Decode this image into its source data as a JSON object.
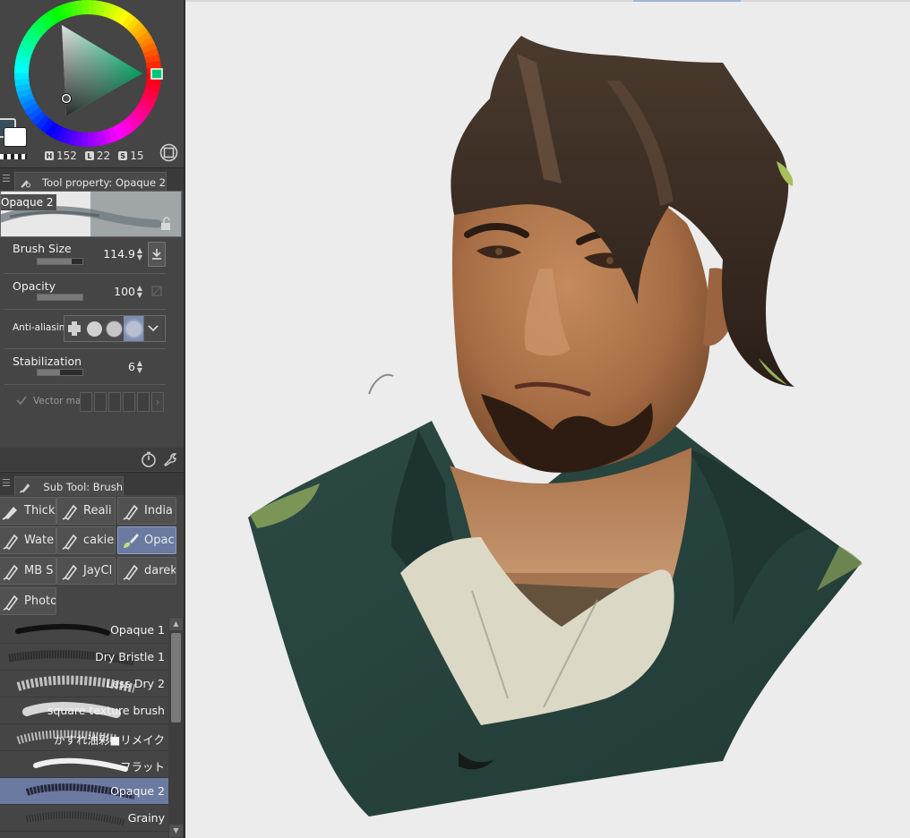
{
  "color_panel": {
    "hls": [
      {
        "key": "H",
        "value": "152"
      },
      {
        "key": "L",
        "value": "22"
      },
      {
        "key": "S",
        "value": "15"
      }
    ],
    "colors": {
      "foreground": "#36505a",
      "background": "#ffffff",
      "selected_hue": "#00c878"
    }
  },
  "tool_property": {
    "tab_label": "Tool property: Opaque 2",
    "preview_name": "Opaque 2",
    "brush_size": {
      "label": "Brush Size",
      "value": "114.9",
      "level": 0.75
    },
    "opacity": {
      "label": "Opacity",
      "value": "100",
      "level": 1.0
    },
    "anti_aliasing": {
      "label": "Anti-aliasing",
      "selected_index": 3
    },
    "stabilization": {
      "label": "Stabilization",
      "value": "6",
      "level": 0.5
    },
    "vector_magnet": {
      "label": "Vector ma"
    }
  },
  "sub_tool": {
    "tab_label": "Sub Tool: Brush",
    "buttons": [
      {
        "label": "Thick",
        "icon": "marker-icon"
      },
      {
        "label": "Reali",
        "icon": "pen-icon"
      },
      {
        "label": "India",
        "icon": "pen-icon"
      },
      {
        "label": "Wate",
        "icon": "pen-icon"
      },
      {
        "label": "cakie",
        "icon": "pen-icon"
      },
      {
        "label": "Opac",
        "icon": "brush-icon",
        "selected": true
      },
      {
        "label": "MB S",
        "icon": "pen-icon"
      },
      {
        "label": "JayCl",
        "icon": "pen-icon"
      },
      {
        "label": "darek",
        "icon": "pen-icon"
      },
      {
        "label": "Photo",
        "icon": "pen-icon"
      }
    ]
  },
  "brush_list": {
    "items": [
      {
        "label": "Opaque 1"
      },
      {
        "label": "Dry Bristle 1"
      },
      {
        "label": "Less Dry 2"
      },
      {
        "label": "square texture brush"
      },
      {
        "label": "かすれ油彩■リメイク"
      },
      {
        "label": "フラット"
      },
      {
        "label": "Opaque 2",
        "selected": true
      },
      {
        "label": "Grainy"
      }
    ]
  },
  "canvas": {
    "artwork": "painted portrait of a bearded man with brown hair in a dark green jacket and white shirt"
  }
}
